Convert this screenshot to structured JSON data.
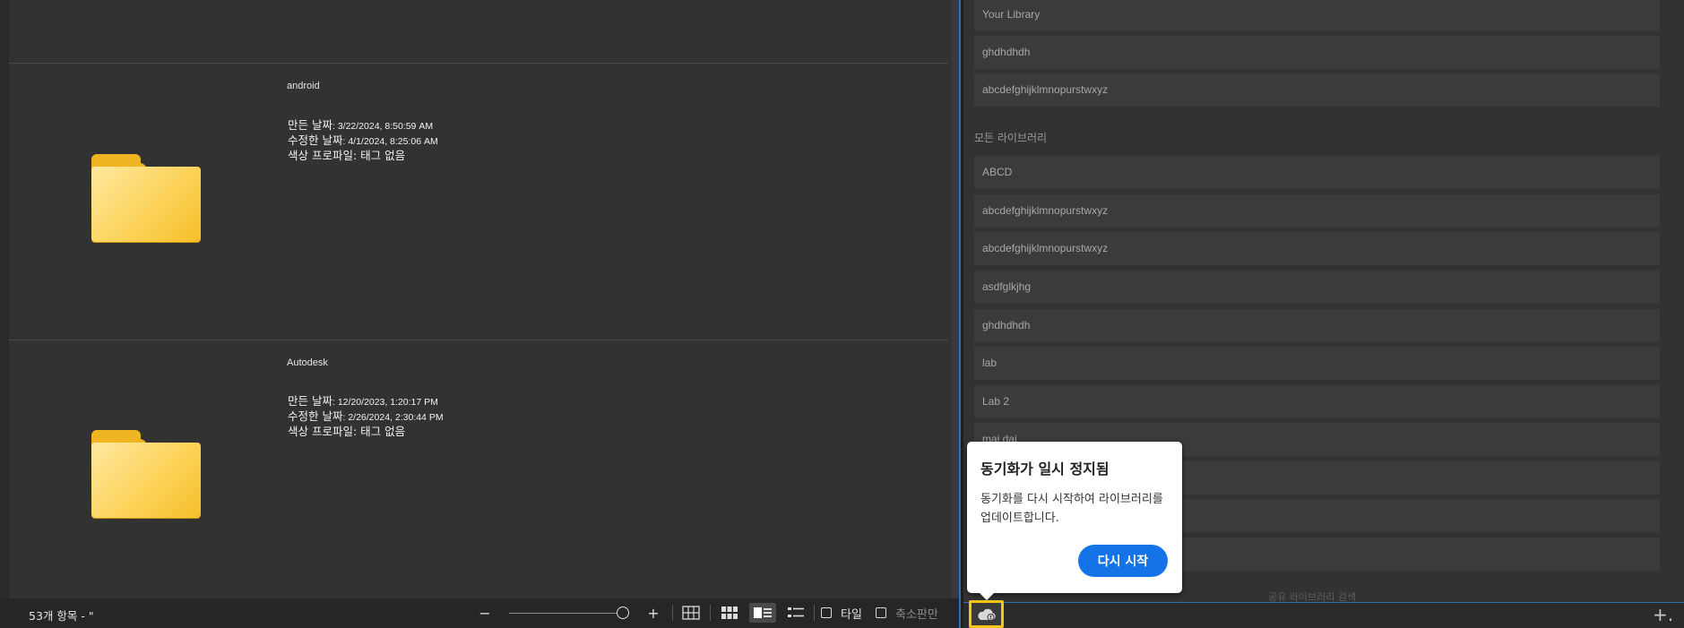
{
  "items": [
    {
      "name": "android",
      "created_label": "만든 날짜",
      "created_value": ": 3/22/2024, 8:50:59 AM",
      "modified_label": "수정한 날짜",
      "modified_value": ": 4/1/2024, 8:25:06 AM",
      "color_label": "색상 프로파일",
      "color_value": ": 태그 없음"
    },
    {
      "name": "Autodesk",
      "created_label": "만든 날짜",
      "created_value": ": 12/20/2023, 1:20:17 PM",
      "modified_label": "수정한 날짜",
      "modified_value": ": 2/26/2024, 2:30:44 PM",
      "color_label": "색상 프로파일",
      "color_value": ": 태그 없음"
    }
  ],
  "status_bar": {
    "count_text": "53개 항목 - \"",
    "zoom_out": "−",
    "zoom_in": "+",
    "tile_label": "타일",
    "thumbnail_only_label": "축소판만"
  },
  "library": {
    "your_library_items": [
      "Your Library",
      "ghdhdhdh",
      "abcdefghijklmnopurstwxyz"
    ],
    "section_label": "모든 라이브러리",
    "all_library_items": [
      "ABCD",
      "abcdefghijklmnopurstwxyz",
      "abcdefghijklmnopurstwxyz",
      "asdfglkjhg",
      "ghdhdhdh",
      "lab",
      "Lab 2",
      "mai dai",
      "",
      "",
      ""
    ],
    "shared_search": "공유 라이브러리 검색",
    "add_label": "+."
  },
  "popover": {
    "title": "동기화가 일시 정지됨",
    "body": "동기화를 다시 시작하여 라이브러리를 업데이트합니다.",
    "button": "다시 시작"
  },
  "colors": {
    "accent_blue": "#1473e6",
    "highlight_yellow": "#f5c518",
    "folder_yellow": "#fcd35a"
  }
}
